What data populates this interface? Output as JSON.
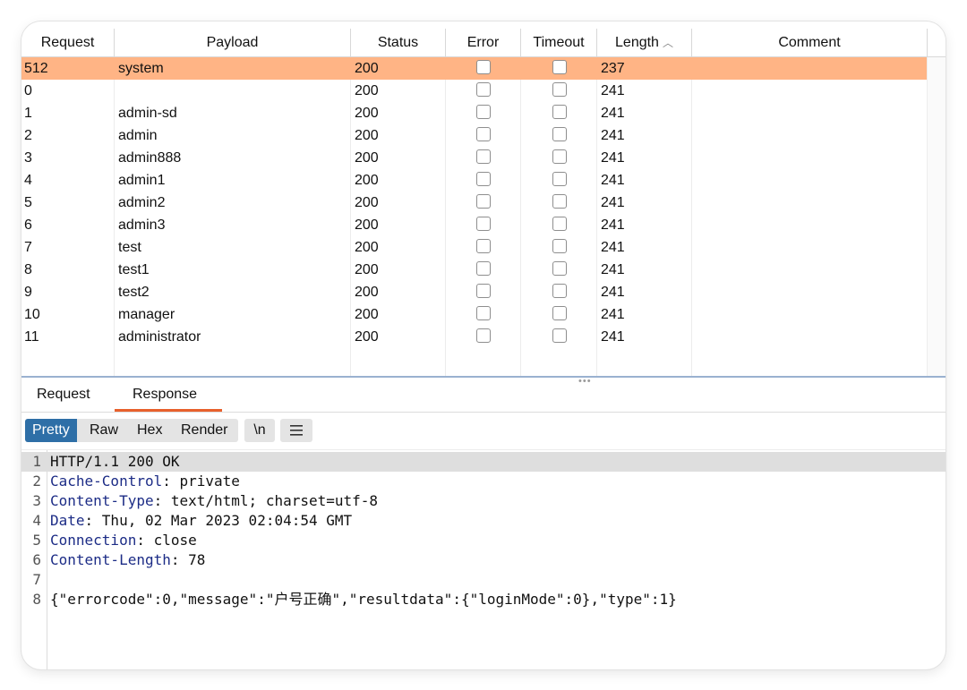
{
  "columns": {
    "request": "Request",
    "payload": "Payload",
    "status": "Status",
    "error": "Error",
    "timeout": "Timeout",
    "length": "Length",
    "length_sort_icon": "chevron-up-icon",
    "comment": "Comment"
  },
  "rows": [
    {
      "request": "512",
      "payload": "system",
      "status": "200",
      "error": false,
      "timeout": false,
      "length": "237",
      "comment": "",
      "selected": true
    },
    {
      "request": "0",
      "payload": "",
      "status": "200",
      "error": false,
      "timeout": false,
      "length": "241",
      "comment": ""
    },
    {
      "request": "1",
      "payload": "admin-sd",
      "status": "200",
      "error": false,
      "timeout": false,
      "length": "241",
      "comment": ""
    },
    {
      "request": "2",
      "payload": "admin",
      "status": "200",
      "error": false,
      "timeout": false,
      "length": "241",
      "comment": ""
    },
    {
      "request": "3",
      "payload": "admin888",
      "status": "200",
      "error": false,
      "timeout": false,
      "length": "241",
      "comment": ""
    },
    {
      "request": "4",
      "payload": "admin1",
      "status": "200",
      "error": false,
      "timeout": false,
      "length": "241",
      "comment": ""
    },
    {
      "request": "5",
      "payload": "admin2",
      "status": "200",
      "error": false,
      "timeout": false,
      "length": "241",
      "comment": ""
    },
    {
      "request": "6",
      "payload": "admin3",
      "status": "200",
      "error": false,
      "timeout": false,
      "length": "241",
      "comment": ""
    },
    {
      "request": "7",
      "payload": "test",
      "status": "200",
      "error": false,
      "timeout": false,
      "length": "241",
      "comment": ""
    },
    {
      "request": "8",
      "payload": "test1",
      "status": "200",
      "error": false,
      "timeout": false,
      "length": "241",
      "comment": ""
    },
    {
      "request": "9",
      "payload": "test2",
      "status": "200",
      "error": false,
      "timeout": false,
      "length": "241",
      "comment": ""
    },
    {
      "request": "10",
      "payload": "manager",
      "status": "200",
      "error": false,
      "timeout": false,
      "length": "241",
      "comment": ""
    },
    {
      "request": "11",
      "payload": "administrator",
      "status": "200",
      "error": false,
      "timeout": false,
      "length": "241",
      "comment": ""
    }
  ],
  "detail_tabs": {
    "request": "Request",
    "response": "Response",
    "active": "response"
  },
  "viewer_toolbar": {
    "pretty": "Pretty",
    "raw": "Raw",
    "hex": "Hex",
    "render": "Render",
    "newline": "\\n",
    "menu_icon": "hamburger-menu-icon",
    "active": "pretty"
  },
  "response_lines": [
    {
      "num": "1",
      "name": "",
      "value": "HTTP/1.1 200 OK"
    },
    {
      "num": "2",
      "name": "Cache-Control",
      "value": ": private"
    },
    {
      "num": "3",
      "name": "Content-Type",
      "value": ": text/html; charset=utf-8"
    },
    {
      "num": "4",
      "name": "Date",
      "value": ": Thu, 02 Mar 2023 02:04:54 GMT"
    },
    {
      "num": "5",
      "name": "Connection",
      "value": ": close"
    },
    {
      "num": "6",
      "name": "Content-Length",
      "value": ": 78"
    },
    {
      "num": "7",
      "name": "",
      "value": ""
    },
    {
      "num": "8",
      "name": "",
      "value": "{\"errorcode\":0,\"message\":\"户号正确\",\"resultdata\":{\"loginMode\":0},\"type\":1}"
    }
  ],
  "colors": {
    "selected_row": "#ffb485",
    "active_tab_underline": "#e8602c",
    "active_view_button": "#2e6fa7",
    "header_name": "#1c2c86"
  }
}
